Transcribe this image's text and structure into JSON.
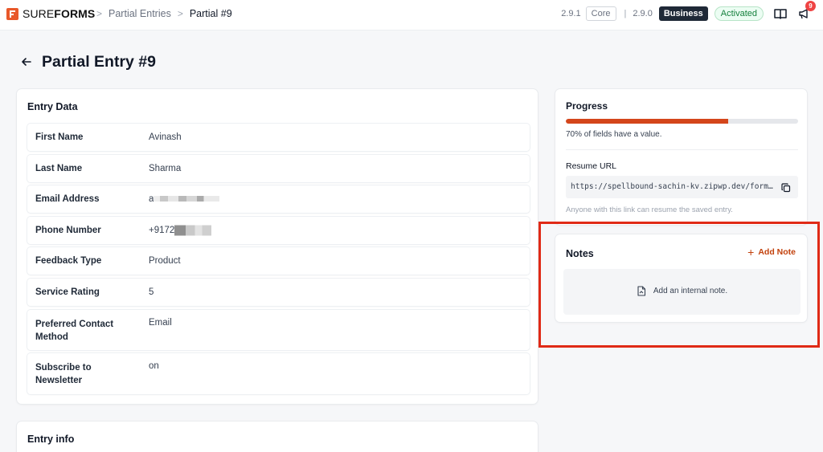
{
  "brand": {
    "name_thin": "SURE",
    "name_bold": "FORMS",
    "accent": "#e8582a"
  },
  "breadcrumb": {
    "items": [
      "Partial Entries"
    ],
    "current": "Partial #9"
  },
  "header": {
    "core_version": "2.9.1",
    "core_label": "Core",
    "business_version": "2.9.0",
    "business_label": "Business",
    "status": "Activated",
    "notification_count": "9"
  },
  "page": {
    "title": "Partial Entry #9"
  },
  "entry_data": {
    "title": "Entry Data",
    "rows": [
      {
        "label": "First Name",
        "value": "Avinash"
      },
      {
        "label": "Last Name",
        "value": "Sharma"
      },
      {
        "label": "Email Address",
        "value": "a"
      },
      {
        "label": "Phone Number",
        "value": "+9172"
      },
      {
        "label": "Feedback Type",
        "value": "Product"
      },
      {
        "label": "Service Rating",
        "value": "5"
      },
      {
        "label": "Preferred Contact Method",
        "value": "Email"
      },
      {
        "label": "Subscribe to Newsletter",
        "value": "on"
      }
    ]
  },
  "entry_info": {
    "title": "Entry info"
  },
  "progress": {
    "title": "Progress",
    "percent": 70,
    "text": "70% of fields have a value.",
    "color": "#d4461b"
  },
  "resume": {
    "title": "Resume URL",
    "url": "https://spellbound-sachin-kv.zipwp.dev/form…",
    "hint": "Anyone with this link can resume the saved entry."
  },
  "notes": {
    "title": "Notes",
    "add_label": "Add Note",
    "empty_text": "Add an internal note."
  },
  "highlight_color": "#e02a16"
}
